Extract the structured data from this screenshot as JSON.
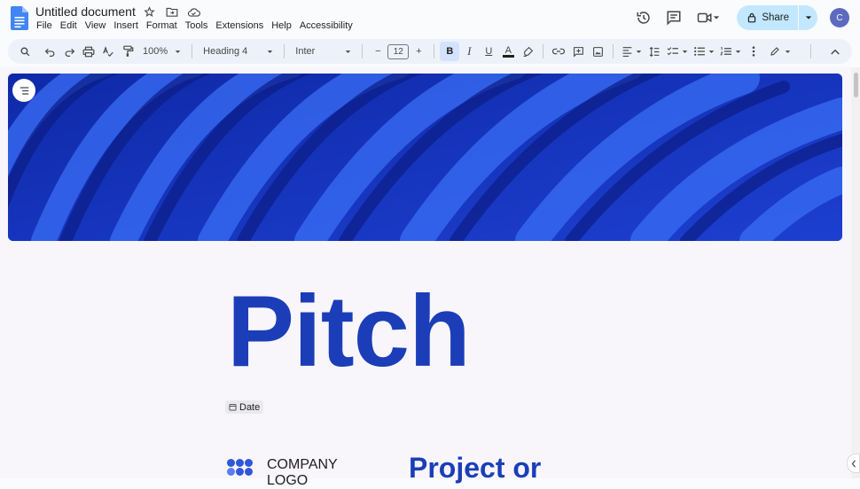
{
  "app": {
    "title": "Untitled document",
    "menu": [
      "File",
      "Edit",
      "View",
      "Insert",
      "Format",
      "Tools",
      "Extensions",
      "Help",
      "Accessibility"
    ]
  },
  "header": {
    "share_label": "Share",
    "avatar_initial": "C",
    "icons": [
      "history-icon",
      "comment-icon",
      "meet-icon",
      "lock-icon"
    ]
  },
  "toolbar": {
    "zoom": "100%",
    "style": "Heading 4",
    "font": "Inter",
    "font_size": "12",
    "bold_label": "B",
    "italic_label": "I",
    "underline_label": "U",
    "text_color_label": "A",
    "minus_label": "−",
    "plus_label": "+"
  },
  "document": {
    "heading": "Pitch",
    "date_chip": "Date",
    "company_logo_line1": "COMPANY",
    "company_logo_line2": "LOGO",
    "project_heading": "Project or"
  },
  "colors": {
    "accent_blue": "#1b3eb8",
    "share_bg": "#c2e7ff",
    "toolbar_bg": "#edf2fa",
    "banner_blue": "#1632b8"
  }
}
